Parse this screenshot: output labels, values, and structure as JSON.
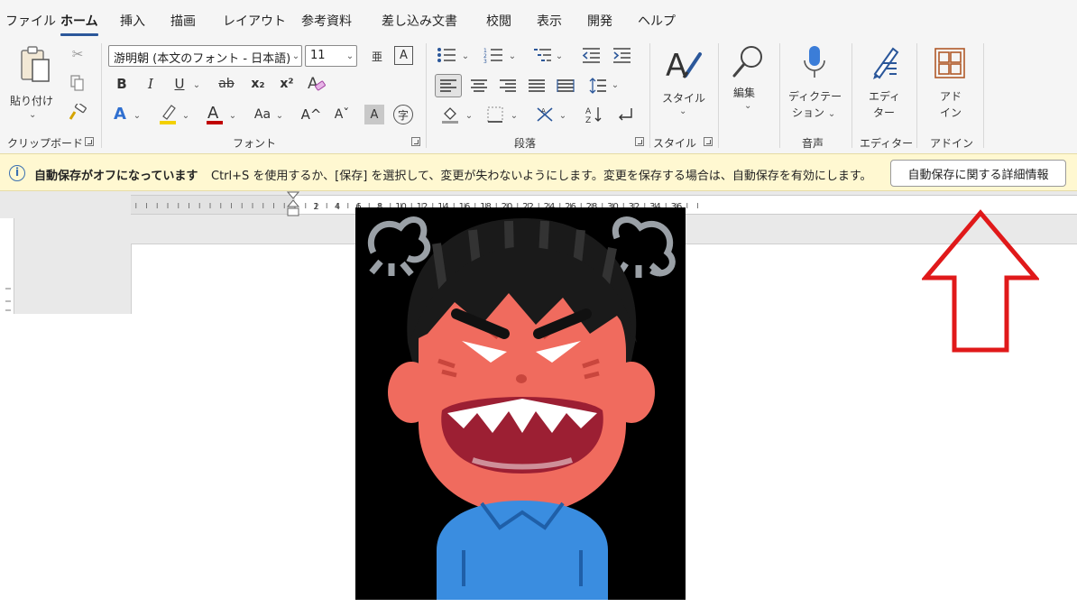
{
  "menu": {
    "tabs": [
      "ファイル",
      "ホーム",
      "挿入",
      "描画",
      "レイアウト",
      "参考資料",
      "差し込み文書",
      "校閲",
      "表示",
      "開発",
      "ヘルプ"
    ],
    "active_tab": "ホーム"
  },
  "clipboard": {
    "paste_label": "貼り付け",
    "group_label": "クリップボード"
  },
  "font": {
    "font_name": "游明朝 (本文のフォント - 日本語)",
    "font_size": "11",
    "group_label": "フォント",
    "bold": "B",
    "italic": "I",
    "underline": "U",
    "strike": "ab",
    "subscript": "x₂",
    "superscript": "x²",
    "change_case": "Aa",
    "grow": "A^",
    "shrink": "Aˇ"
  },
  "paragraph": {
    "group_label": "段落"
  },
  "styles": {
    "label": "スタイル",
    "group_label": "スタイル"
  },
  "editing": {
    "label": "編集"
  },
  "voice": {
    "label_line1": "ディクテー",
    "label_line2": "ション",
    "group_label": "音声"
  },
  "editor": {
    "label_line1": "エディ",
    "label_line2": "ター",
    "group_label": "エディター"
  },
  "addins": {
    "label_line1": "アド",
    "label_line2": "イン",
    "group_label": "アドイン"
  },
  "infobar": {
    "title": "自動保存がオフになっています",
    "message": "Ctrl+S を使用するか、[保存] を選択して、変更が失わないようにします。変更を保存する場合は、自動保存を有効にします。",
    "button": "自動保存に関する詳細情報"
  },
  "ruler": {
    "labels": [
      "2",
      "4",
      "6",
      "8",
      "10",
      "12",
      "14",
      "16",
      "18",
      "20",
      "22",
      "24",
      "26",
      "28",
      "30",
      "32",
      "34",
      "36"
    ]
  },
  "colors": {
    "accent": "#2b579a",
    "highlight": "#f3d000",
    "font_color": "#c00000",
    "arrow": "#e0191a",
    "infobar_bg": "#fff8d1"
  }
}
